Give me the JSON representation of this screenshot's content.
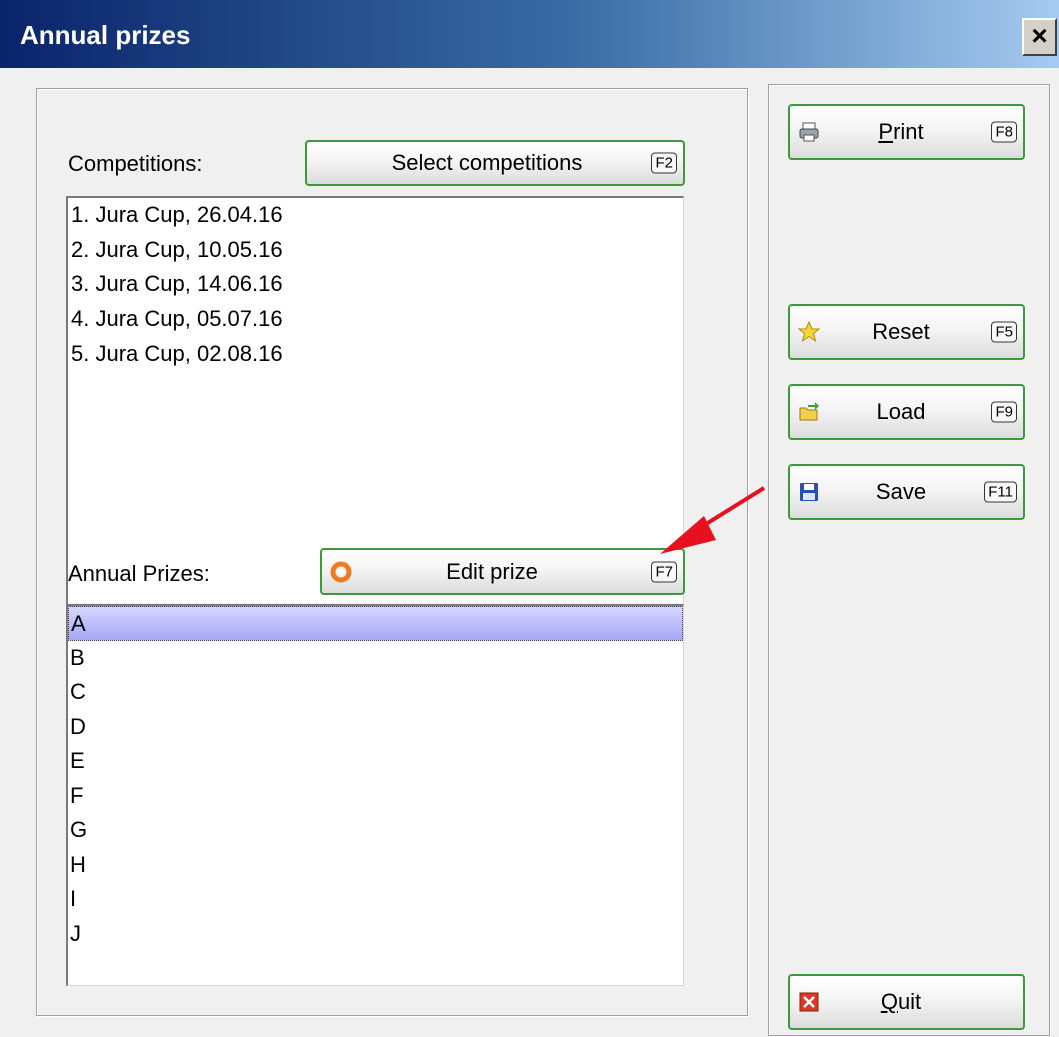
{
  "window": {
    "title": "Annual prizes",
    "close_label": "×"
  },
  "competitions": {
    "label": "Competitions:",
    "select_button": {
      "label": "Select competitions",
      "key": "F2"
    },
    "items": [
      "1. Jura Cup, 26.04.16",
      "2. Jura Cup, 10.05.16",
      "3. Jura Cup, 14.06.16",
      "4. Jura Cup, 05.07.16",
      "5. Jura Cup, 02.08.16"
    ]
  },
  "annual_prizes": {
    "label": "Annual Prizes:",
    "edit_button": {
      "label": "Edit prize",
      "key": "F7"
    },
    "items": [
      "A",
      "B",
      "C",
      "D",
      "E",
      "F",
      "G",
      "H",
      "I",
      "J"
    ],
    "selected_index": 0
  },
  "actions": {
    "print": {
      "label_mnemonic": "P",
      "label_rest": "rint",
      "key": "F8"
    },
    "reset": {
      "label": "Reset",
      "key": "F5"
    },
    "load": {
      "label": "Load",
      "key": "F9"
    },
    "save": {
      "label": "Save",
      "key": "F11"
    },
    "quit": {
      "label_mnemonic": "Q",
      "label_rest": "uit"
    }
  },
  "colors": {
    "button_border": "#3c9a3c",
    "selection": "#a7a7f4",
    "annotation_arrow": "#e8101e"
  }
}
